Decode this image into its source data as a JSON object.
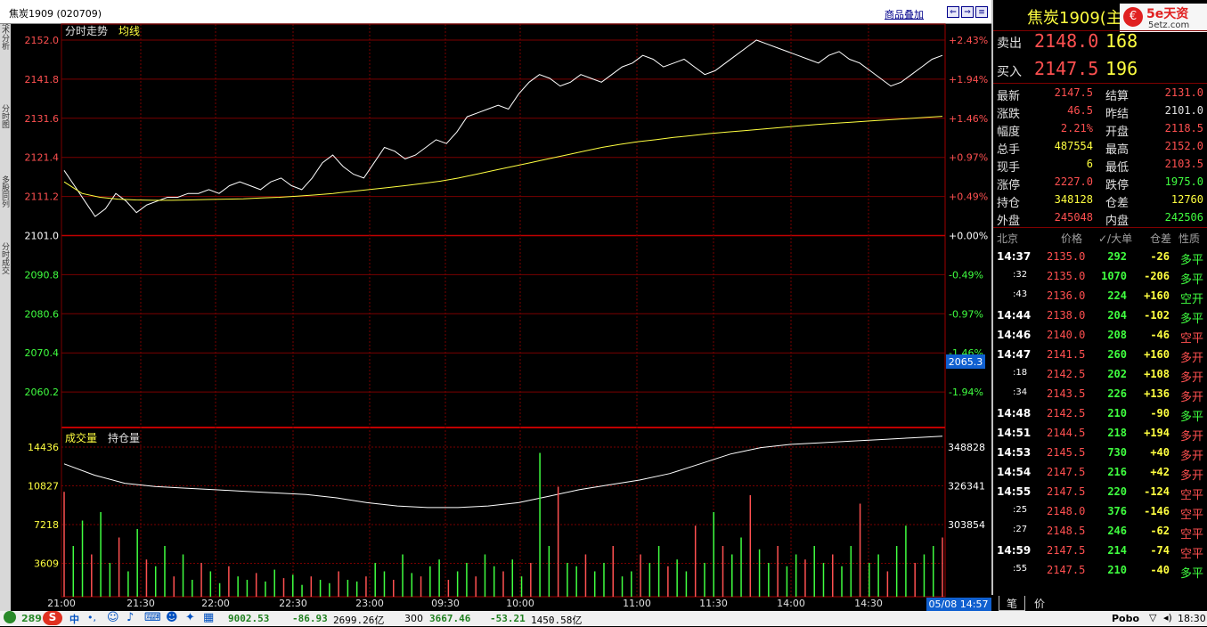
{
  "window": {
    "title": "焦炭1909 (020709)",
    "overlay_link": "商品叠加",
    "left_tabs": [
      "技术分析",
      "分时图",
      "多股同列",
      "分时成交"
    ]
  },
  "intraday": {
    "panel_label": "分时走势",
    "avg_label": "均线",
    "price_ticks": [
      {
        "p": "2152.0",
        "pct": "+2.43%"
      },
      {
        "p": "2141.8",
        "pct": "+1.94%"
      },
      {
        "p": "2131.6",
        "pct": "+1.46%"
      },
      {
        "p": "2121.4",
        "pct": "+0.97%"
      },
      {
        "p": "2111.2",
        "pct": "+0.49%"
      },
      {
        "p": "2101.0",
        "pct": "+0.00%"
      },
      {
        "p": "2090.8",
        "pct": "-0.49%"
      },
      {
        "p": "2080.6",
        "pct": "-0.97%"
      },
      {
        "p": "2070.4",
        "pct": "-1.46%"
      },
      {
        "p": "2060.2",
        "pct": "-1.94%"
      }
    ],
    "cursor_price": "2065.3",
    "price_series": [
      2118,
      2114,
      2110,
      2106,
      2108,
      2112,
      2110,
      2107,
      2109,
      2110,
      2111,
      2111,
      2112,
      2112,
      2113,
      2112,
      2114,
      2115,
      2114,
      2113,
      2115,
      2116,
      2114,
      2113,
      2116,
      2120,
      2122,
      2119,
      2117,
      2116,
      2120,
      2124,
      2123,
      2121,
      2122,
      2124,
      2126,
      2125,
      2128,
      2132,
      2133,
      2134,
      2135,
      2134,
      2138,
      2141,
      2143,
      2142,
      2140,
      2141,
      2143,
      2142,
      2141,
      2143,
      2145,
      2146,
      2148,
      2147,
      2145,
      2146,
      2147,
      2145,
      2143,
      2144,
      2146,
      2148,
      2150,
      2152,
      2151,
      2150,
      2149,
      2148,
      2147,
      2146,
      2148,
      2149,
      2147,
      2146,
      2144,
      2142,
      2140,
      2141,
      2143,
      2145,
      2147,
      2148
    ],
    "avg_series": [
      2115,
      2112,
      2111,
      2110.5,
      2110.3,
      2110.2,
      2110.2,
      2110.3,
      2110.4,
      2110.5,
      2110.6,
      2110.8,
      2111,
      2111.3,
      2111.6,
      2112,
      2112.5,
      2113,
      2113.5,
      2114,
      2114.6,
      2115.2,
      2116,
      2117,
      2118,
      2119,
      2120,
      2121,
      2122,
      2123,
      2124,
      2124.8,
      2125.5,
      2126,
      2126.6,
      2127.1,
      2127.6,
      2128,
      2128.4,
      2128.8,
      2129.2,
      2129.6,
      2130,
      2130.3,
      2130.6,
      2130.9,
      2131.2,
      2131.5,
      2131.8,
      2132.1
    ]
  },
  "volume": {
    "panel_label": "成交量",
    "oi_label": "持仓量",
    "left_ticks": [
      "14436",
      "10827",
      "7218",
      "3609"
    ],
    "right_ticks": [
      "348828",
      "326341",
      "303854"
    ],
    "oi_series": [
      0.82,
      0.75,
      0.7,
      0.68,
      0.67,
      0.66,
      0.65,
      0.64,
      0.63,
      0.61,
      0.58,
      0.56,
      0.55,
      0.55,
      0.56,
      0.58,
      0.62,
      0.66,
      0.69,
      0.72,
      0.76,
      0.82,
      0.88,
      0.92,
      0.94,
      0.95,
      0.96,
      0.97,
      0.98,
      0.99
    ],
    "bars": [
      0.62,
      0.3,
      0.45,
      0.25,
      0.5,
      0.2,
      0.35,
      0.15,
      0.4,
      0.22,
      0.18,
      0.3,
      0.12,
      0.25,
      0.1,
      0.2,
      0.15,
      0.08,
      0.18,
      0.12,
      0.1,
      0.14,
      0.09,
      0.16,
      0.11,
      0.13,
      0.07,
      0.12,
      0.1,
      0.08,
      0.15,
      0.1,
      0.09,
      0.12,
      0.2,
      0.15,
      0.1,
      0.25,
      0.14,
      0.12,
      0.18,
      0.22,
      0.1,
      0.15,
      0.2,
      0.12,
      0.25,
      0.18,
      0.15,
      0.22,
      0.12,
      0.2,
      0.85,
      0.3,
      0.65,
      0.2,
      0.18,
      0.25,
      0.15,
      0.2,
      0.3,
      0.12,
      0.15,
      0.25,
      0.2,
      0.3,
      0.18,
      0.22,
      0.15,
      0.42,
      0.2,
      0.5,
      0.3,
      0.25,
      0.35,
      0.6,
      0.28,
      0.2,
      0.3,
      0.18,
      0.25,
      0.22,
      0.3,
      0.2,
      0.25,
      0.18,
      0.3,
      0.55,
      0.2,
      0.25,
      0.15,
      0.3,
      0.42,
      0.2,
      0.25,
      0.3,
      0.35
    ]
  },
  "time_axis": [
    "21:00",
    "21:30",
    "22:00",
    "22:30",
    "23:00",
    "09:30",
    "10:00",
    "11:00",
    "11:30",
    "14:00",
    "14:30"
  ],
  "time_cursor": "05/08 14:57",
  "quote": {
    "contract": "焦炭1909(主",
    "brand": "5e天资",
    "brand_url": "5etz.com",
    "sell_label": "卖出",
    "sell_price": "2148.0",
    "sell_vol": "168",
    "buy_label": "买入",
    "buy_price": "2147.5",
    "buy_vol": "196",
    "rows": [
      {
        "l1": "最新",
        "v1": "2147.5",
        "c1": "#ff5050",
        "l2": "结算",
        "v2": "2131.0",
        "c2": "#ff5050"
      },
      {
        "l1": "涨跌",
        "v1": "46.5",
        "c1": "#ff5050",
        "l2": "昨结",
        "v2": "2101.0",
        "c2": "#e0e0e0"
      },
      {
        "l1": "幅度",
        "v1": "2.21%",
        "c1": "#ff5050",
        "l2": "开盘",
        "v2": "2118.5",
        "c2": "#ff5050"
      },
      {
        "l1": "总手",
        "v1": "487554",
        "c1": "#ffff40",
        "l2": "最高",
        "v2": "2152.0",
        "c2": "#ff5050"
      },
      {
        "l1": "现手",
        "v1": "6",
        "c1": "#ffff40",
        "l2": "最低",
        "v2": "2103.5",
        "c2": "#ff5050"
      },
      {
        "l1": "涨停",
        "v1": "2227.0",
        "c1": "#ff5050",
        "l2": "跌停",
        "v2": "1975.0",
        "c2": "#40ff40"
      },
      {
        "l1": "持仓",
        "v1": "348128",
        "c1": "#ffff40",
        "l2": "仓差",
        "v2": "12760",
        "c2": "#ffff40"
      },
      {
        "l1": "外盘",
        "v1": "245048",
        "c1": "#ff5050",
        "l2": "内盘",
        "v2": "242506",
        "c2": "#40ff40"
      }
    ],
    "trade_header": [
      "北京",
      "价格",
      "✓/大单",
      "仓差",
      "性质"
    ],
    "trades": [
      {
        "t": "14:37",
        "big": true,
        "p": "2135.0",
        "v": "292",
        "d": "-26",
        "n": "多平",
        "dc": "#ffff40",
        "nc": "#40ff40"
      },
      {
        "t": ":32",
        "big": false,
        "p": "2135.0",
        "v": "1070",
        "d": "-206",
        "n": "多平",
        "dc": "#ffff40",
        "nc": "#40ff40"
      },
      {
        "t": ":43",
        "big": false,
        "p": "2136.0",
        "v": "224",
        "d": "+160",
        "n": "空开",
        "dc": "#ffff40",
        "nc": "#40ff40"
      },
      {
        "t": "14:44",
        "big": true,
        "p": "2138.0",
        "v": "204",
        "d": "-102",
        "n": "多平",
        "dc": "#ffff40",
        "nc": "#40ff40"
      },
      {
        "t": "14:46",
        "big": true,
        "p": "2140.0",
        "v": "208",
        "d": "-46",
        "n": "空平",
        "dc": "#ffff40",
        "nc": "#ff5050"
      },
      {
        "t": "14:47",
        "big": true,
        "p": "2141.5",
        "v": "260",
        "d": "+160",
        "n": "多开",
        "dc": "#ffff40",
        "nc": "#ff5050"
      },
      {
        "t": ":18",
        "big": false,
        "p": "2142.5",
        "v": "202",
        "d": "+108",
        "n": "多开",
        "dc": "#ffff40",
        "nc": "#ff5050"
      },
      {
        "t": ":34",
        "big": false,
        "p": "2143.5",
        "v": "226",
        "d": "+136",
        "n": "多开",
        "dc": "#ffff40",
        "nc": "#ff5050"
      },
      {
        "t": "14:48",
        "big": true,
        "p": "2142.5",
        "v": "210",
        "d": "-90",
        "n": "多平",
        "dc": "#ffff40",
        "nc": "#40ff40"
      },
      {
        "t": "14:51",
        "big": true,
        "p": "2144.5",
        "v": "218",
        "d": "+194",
        "n": "多开",
        "dc": "#ffff40",
        "nc": "#ff5050"
      },
      {
        "t": "14:53",
        "big": true,
        "p": "2145.5",
        "v": "730",
        "d": "+40",
        "n": "多开",
        "dc": "#ffff40",
        "nc": "#ff5050"
      },
      {
        "t": "14:54",
        "big": true,
        "p": "2147.5",
        "v": "216",
        "d": "+42",
        "n": "多开",
        "dc": "#ffff40",
        "nc": "#ff5050"
      },
      {
        "t": "14:55",
        "big": true,
        "p": "2147.5",
        "v": "220",
        "d": "-124",
        "n": "空平",
        "dc": "#ffff40",
        "nc": "#ff5050"
      },
      {
        "t": ":25",
        "big": false,
        "p": "2148.0",
        "v": "376",
        "d": "-146",
        "n": "空平",
        "dc": "#ffff40",
        "nc": "#ff5050"
      },
      {
        "t": ":27",
        "big": false,
        "p": "2148.5",
        "v": "246",
        "d": "-62",
        "n": "空平",
        "dc": "#ffff40",
        "nc": "#ff5050"
      },
      {
        "t": "14:59",
        "big": true,
        "p": "2147.5",
        "v": "214",
        "d": "-74",
        "n": "空平",
        "dc": "#ffff40",
        "nc": "#ff5050"
      },
      {
        "t": ":55",
        "big": false,
        "p": "2147.5",
        "v": "210",
        "d": "-40",
        "n": "多平",
        "dc": "#ffff40",
        "nc": "#40ff40"
      }
    ],
    "tabs": [
      "笔",
      "价"
    ]
  },
  "bottom": {
    "left_num": "289",
    "ime": "中",
    "idx1_val": "9002.53",
    "idx1_chg": "-86.93",
    "idx1_amt": "2699.26亿",
    "idx2_name": "300",
    "idx2_val": "3667.46",
    "idx2_chg": "-53.21",
    "idx2_amt": "1450.58亿",
    "brand": "Pobo",
    "clock": "18:30"
  }
}
